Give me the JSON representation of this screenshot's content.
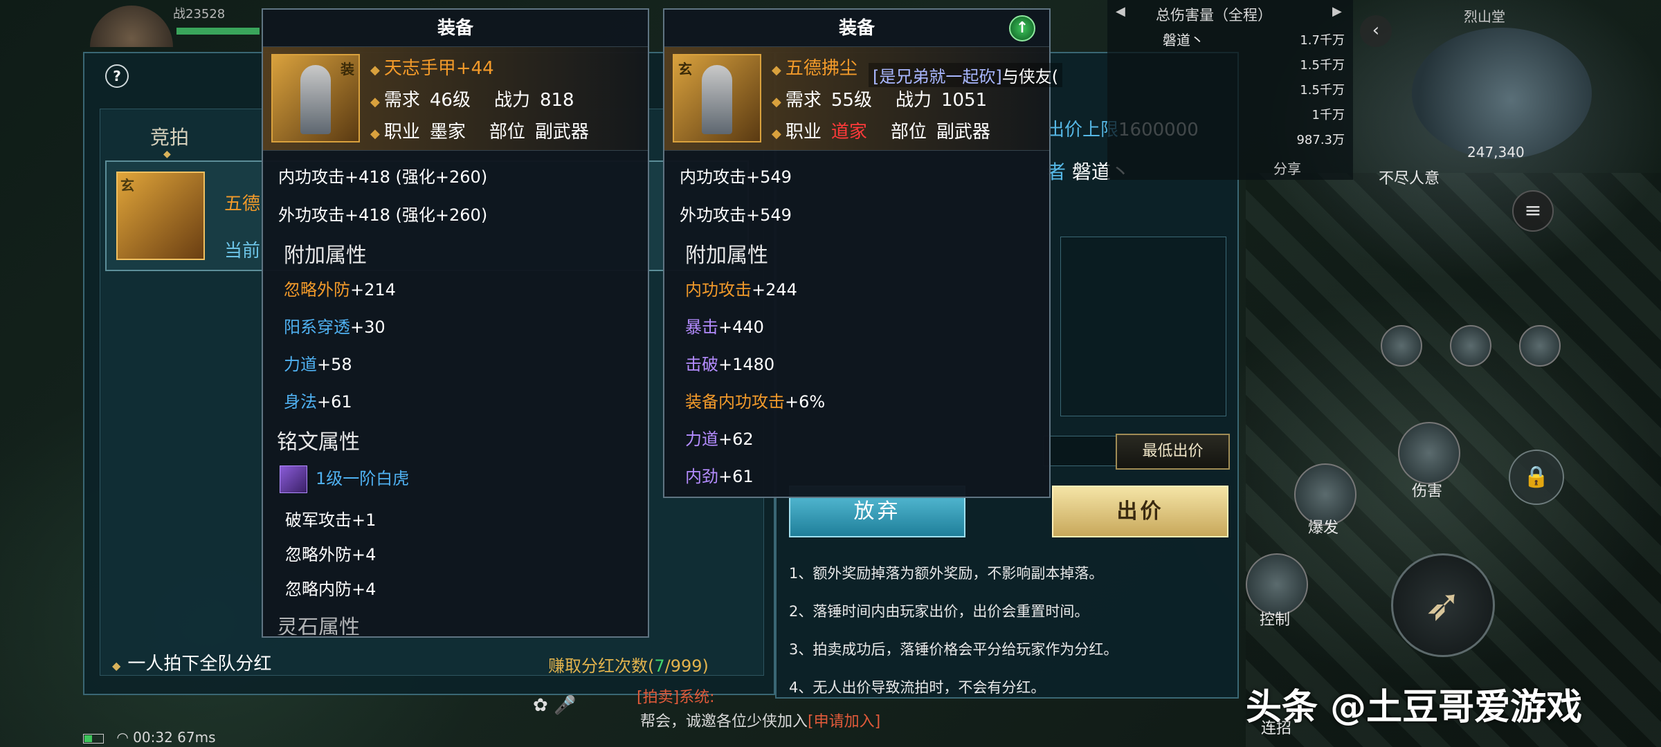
{
  "hud": {
    "combat_power": "战23528"
  },
  "auction": {
    "help": "?",
    "tab_bidding": "竞拍",
    "item": {
      "badge": "玄",
      "name_fragment": "五德",
      "current_fragment": "当前"
    },
    "team_bonus": "一人拍下全队分红",
    "bonus_label": "赚取分红次数(",
    "bonus_current": "7",
    "bonus_total": "/999)"
  },
  "bid_panel": {
    "limit_label": "出价上限",
    "limit_value": "1600000",
    "bidder_label": "者",
    "bidder_name": "磐道丶",
    "min_bid_button": "最低出价",
    "give_up_button": "放弃",
    "bid_button": "出价",
    "rules": [
      "1、额外奖励掉落为额外奖励，不影响副本掉落。",
      "2、落锤时间内由玩家出价，出价会重置时间。",
      "3、拍卖成功后，落锤价格会平分给玩家作为分红。",
      "4、无人出价导致流拍时，不会有分红。"
    ]
  },
  "tooltip_left": {
    "title": "装备",
    "icon_badge": "装",
    "name": "天志手甲+44",
    "req_label": "需求",
    "req_value": "46级",
    "power_label": "战力",
    "power_value": "818",
    "class_label": "职业",
    "class_value": "墨家",
    "slot_label": "部位",
    "slot_value": "副武器",
    "base_stats": [
      "内功攻击+418 (强化+260)",
      "外功攻击+418 (强化+260)"
    ],
    "extra_title": "附加属性",
    "extra": [
      {
        "name": "忽略外防",
        "value": "+214",
        "color": "orange"
      },
      {
        "name": "阳系穿透",
        "value": "+30",
        "color": "blue"
      },
      {
        "name": "力道",
        "value": "+58",
        "color": "blue"
      },
      {
        "name": "身法",
        "value": "+61",
        "color": "blue"
      }
    ],
    "inscription_title": "铭文属性",
    "inscription_name": "1级一阶白虎",
    "inscription_stats": [
      "破军攻击+1",
      "忽略外防+4",
      "忽略内防+4"
    ],
    "gem_title": "灵石属性"
  },
  "tooltip_right": {
    "title": "装备",
    "icon_badge": "玄",
    "name": "五德拂尘",
    "req_label": "需求",
    "req_value": "55级",
    "power_label": "战力",
    "power_value": "1051",
    "class_label": "职业",
    "class_value": "道家",
    "slot_label": "部位",
    "slot_value": "副武器",
    "base_stats": [
      "内功攻击+549",
      "外功攻击+549"
    ],
    "extra_title": "附加属性",
    "extra": [
      {
        "name": "内功攻击",
        "value": "+244",
        "color": "orange"
      },
      {
        "name": "暴击",
        "value": "+440",
        "color": "purple"
      },
      {
        "name": "击破",
        "value": "+1480",
        "color": "purple"
      },
      {
        "name": "装备内功攻击",
        "value": "+6%",
        "color": "orange"
      },
      {
        "name": "力道",
        "value": "+62",
        "color": "purple"
      },
      {
        "name": "内劲",
        "value": "+61",
        "color": "purple"
      }
    ]
  },
  "chat_link": {
    "link": "[是兄弟就一起砍]",
    "text": "与侠友("
  },
  "damage": {
    "title": "总伤害量（全程）",
    "top_name": "磐道丶",
    "values": [
      "1.7千万",
      "1.5千万",
      "1.5千万",
      "1千万",
      "987.3万"
    ],
    "share": "分享"
  },
  "map": {
    "name": "烈山堂",
    "count": "247,340",
    "buff": "不尽人意"
  },
  "skills": {
    "damage": "伤害",
    "burst": "爆发",
    "control": "控制",
    "combo": "连招"
  },
  "chat": {
    "system": "[拍卖]系统:",
    "message_prefix": "帮会，诚邀各位少侠加入",
    "message_link": "[申请加入]"
  },
  "status": {
    "time": "00:32",
    "ping": "67ms"
  },
  "watermark": "头条 @土豆哥爱游戏"
}
